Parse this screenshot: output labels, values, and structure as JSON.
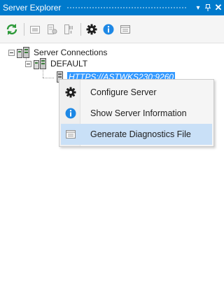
{
  "window": {
    "title": "Server Explorer",
    "pin_glyph": "▾",
    "autohide_glyph": "ᵠ",
    "close_glyph": "✕"
  },
  "toolbar": {
    "buttons": [
      {
        "name": "refresh-icon"
      },
      {
        "name": "add-connection-icon"
      },
      {
        "name": "connect-icon"
      },
      {
        "name": "disconnect-icon"
      },
      {
        "name": "gear-icon"
      },
      {
        "name": "info-icon"
      },
      {
        "name": "diagnostics-icon"
      }
    ]
  },
  "tree": {
    "root_label": "Server Connections",
    "group_label": "DEFAULT",
    "server_label": "HTTPS://ASTWKS230:9260"
  },
  "context_menu": {
    "items": [
      {
        "label": "Configure Server",
        "icon": "gear-icon"
      },
      {
        "label": "Show Server Information",
        "icon": "info-icon"
      },
      {
        "label": "Generate Diagnostics File",
        "icon": "diagnostics-icon",
        "highlighted": true
      }
    ]
  },
  "colors": {
    "accent": "#007acc",
    "selection": "#3399ff",
    "menu_hover": "#c9e0f7",
    "info_blue": "#1e88e5",
    "refresh_green": "#2e9a3a"
  }
}
